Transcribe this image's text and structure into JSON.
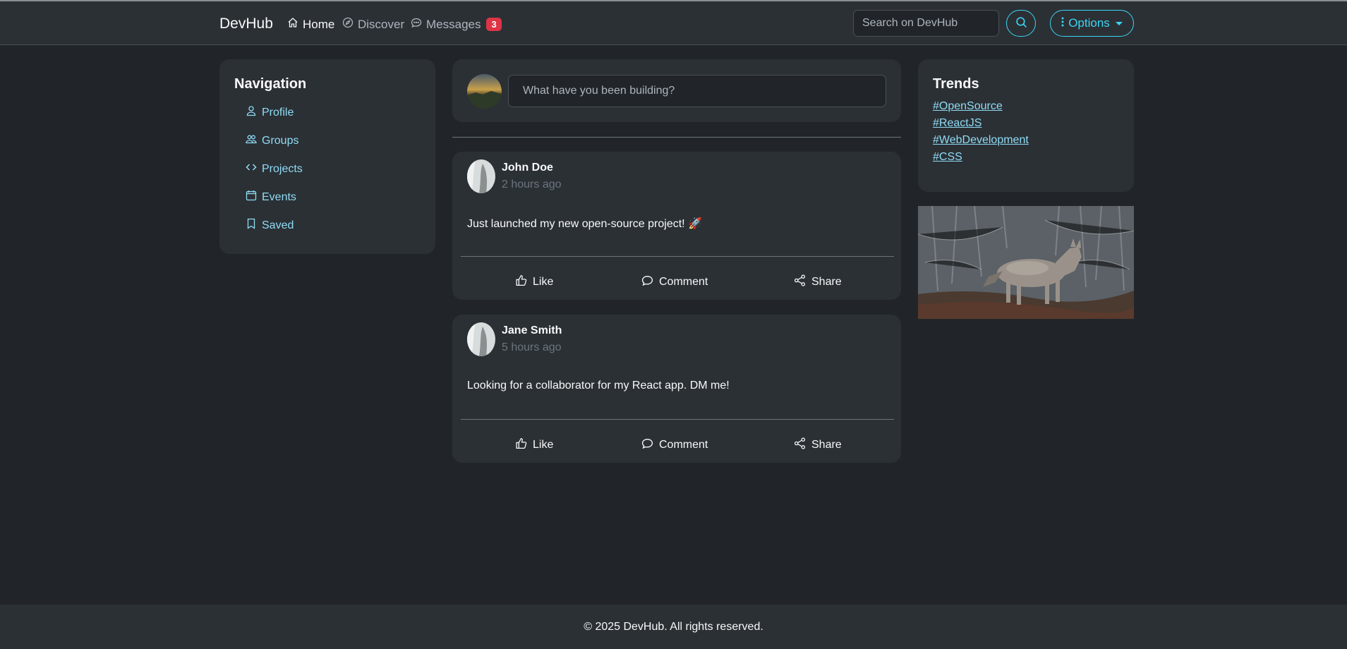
{
  "app": {
    "brand": "DevHub"
  },
  "header": {
    "nav": [
      {
        "label": "Home",
        "icon": "home-icon",
        "active": true
      },
      {
        "label": "Discover",
        "icon": "compass-icon",
        "active": false
      },
      {
        "label": "Messages",
        "icon": "chat-icon",
        "badge": "3"
      }
    ],
    "search_placeholder": "Search on DevHub",
    "options_label": "Options"
  },
  "sidebar": {
    "title": "Navigation",
    "items": [
      {
        "label": "Profile",
        "icon": "person-icon"
      },
      {
        "label": "Groups",
        "icon": "people-icon"
      },
      {
        "label": "Projects",
        "icon": "code-icon"
      },
      {
        "label": "Events",
        "icon": "calendar-icon"
      },
      {
        "label": "Saved",
        "icon": "bookmark-icon"
      }
    ]
  },
  "composer": {
    "placeholder": "What have you been building?"
  },
  "posts": [
    {
      "author": "John Doe",
      "time": "2 hours ago",
      "content": "Just launched my new open-source project! 🚀"
    },
    {
      "author": "Jane Smith",
      "time": "5 hours ago",
      "content": "Looking for a collaborator for my React app. DM me!"
    }
  ],
  "post_actions": {
    "like": "Like",
    "comment": "Comment",
    "share": "Share"
  },
  "trends": {
    "title": "Trends",
    "tags": [
      "#OpenSource",
      "#ReactJS",
      "#WebDevelopment",
      "#CSS"
    ]
  },
  "footer": {
    "text": "© 2025 DevHub. All rights reserved."
  },
  "colors": {
    "accent": "#3dd5f3",
    "link": "#8fdcf5",
    "badge": "#dc3545",
    "background": "#212529",
    "card": "#2b3035"
  }
}
